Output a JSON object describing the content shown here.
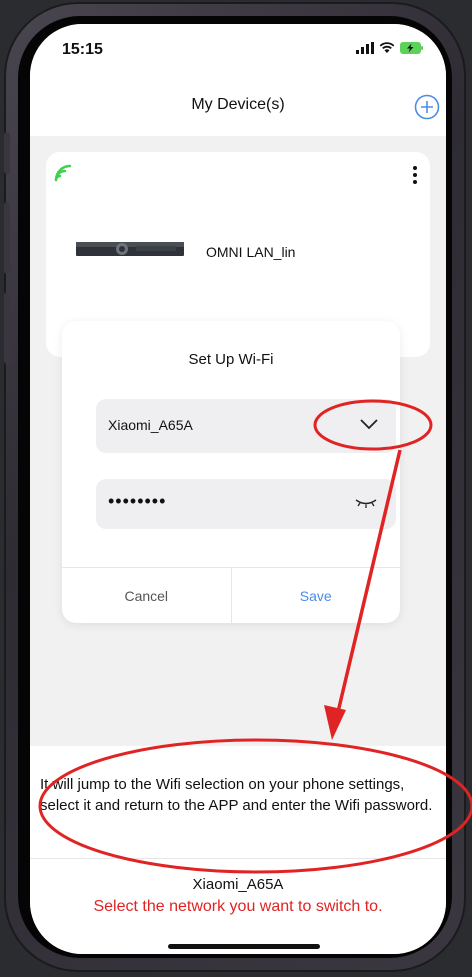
{
  "status_bar": {
    "time": "15:15"
  },
  "header": {
    "title": "My Device(s)",
    "add_icon": "plus-circle-icon"
  },
  "device_card": {
    "signal_icon": "wifi-signal-icon",
    "name": "OMNI LAN_lin"
  },
  "wifi_dialog": {
    "title": "Set Up Wi-Fi",
    "selected_network": "Xiaomi_A65A",
    "password_masked": "••••••••",
    "cancel_label": "Cancel",
    "save_label": "Save"
  },
  "bottom_sheet": {
    "tip": "It will jump to the Wifi selection on your phone settings, select it and return to the APP and enter the Wifi password.",
    "network_name": "Xiaomi_A65A",
    "hint": "Select the network you want to switch to."
  },
  "colors": {
    "accent_blue": "#4c8ce8",
    "signal_green": "#3fd14d",
    "annotation_red": "#e02424"
  }
}
